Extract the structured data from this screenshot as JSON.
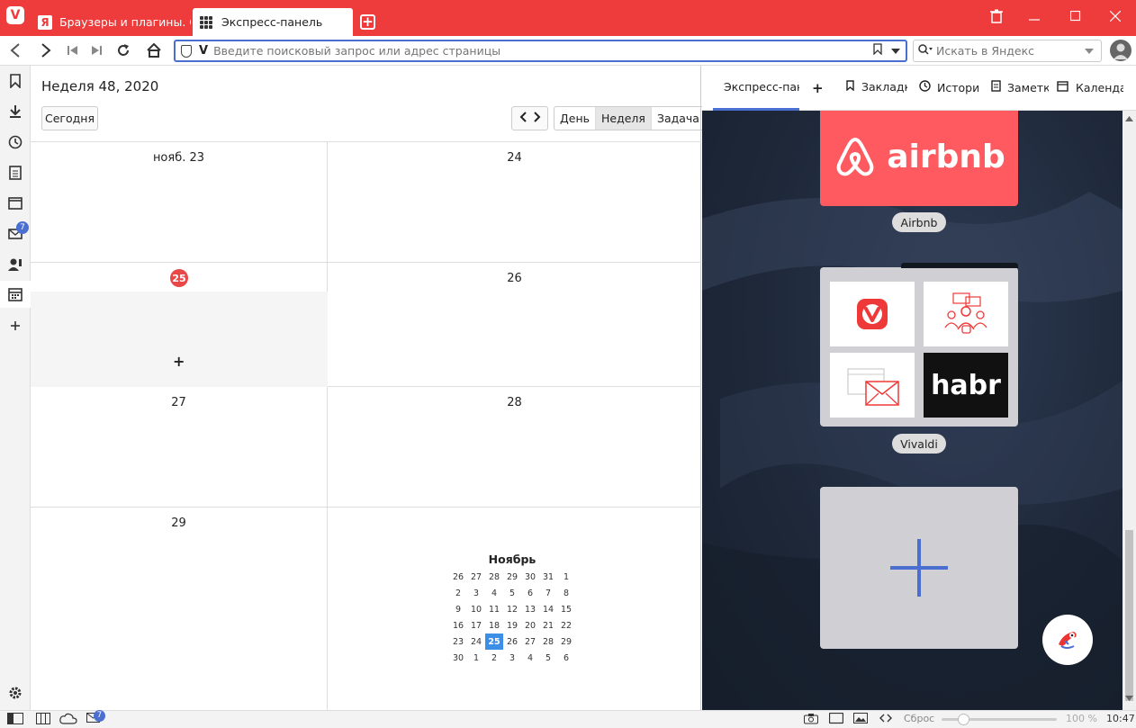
{
  "browser": {
    "tabs": [
      {
        "label": "Браузеры и плагины. Скачать"
      },
      {
        "label": "Экспресс-панель"
      }
    ],
    "address_placeholder": "Введите поисковый запрос или адрес страницы",
    "search_placeholder": "Искать в Яндекс"
  },
  "sidebar": {
    "mail_badge": "7"
  },
  "calendar": {
    "week_title": "Неделя 48, 2020",
    "today_button": "Сегодня",
    "views": [
      "День",
      "Неделя",
      "Задача"
    ],
    "selected_view": "Неделя",
    "days": [
      {
        "label": "нояб. 23"
      },
      {
        "label": "24"
      },
      {
        "label": "25",
        "today": true
      },
      {
        "label": "26"
      },
      {
        "label": "27"
      },
      {
        "label": "28"
      },
      {
        "label": "29"
      }
    ],
    "add_symbol": "+",
    "mini": {
      "month": "Ноябрь",
      "weeks": [
        [
          "26",
          "27",
          "28",
          "29",
          "30",
          "31",
          "1"
        ],
        [
          "2",
          "3",
          "4",
          "5",
          "6",
          "7",
          "8"
        ],
        [
          "9",
          "10",
          "11",
          "12",
          "13",
          "14",
          "15"
        ],
        [
          "16",
          "17",
          "18",
          "19",
          "20",
          "21",
          "22"
        ],
        [
          "23",
          "24",
          "25",
          "26",
          "27",
          "28",
          "29"
        ],
        [
          "30",
          "1",
          "2",
          "3",
          "4",
          "5",
          "6"
        ]
      ],
      "current": "25"
    }
  },
  "panel": {
    "tabs": [
      "Экспресс-панель",
      "Закладки",
      "История",
      "Заметки",
      "Календарь"
    ],
    "add_symbol": "+",
    "dials": [
      {
        "title": "Airbnb",
        "logo_text": "airbnb"
      },
      {
        "title": "Vivaldi",
        "folder_logo": "habr"
      }
    ]
  },
  "statusbar": {
    "reset_label": "Сброс",
    "zoom": "100 %",
    "time": "10:47",
    "mail_badge": "7"
  },
  "colors": {
    "brand": "#ee3b3b",
    "accent": "#4a6fd1",
    "today": "#e94848",
    "airbnb": "#ff5a5f"
  }
}
